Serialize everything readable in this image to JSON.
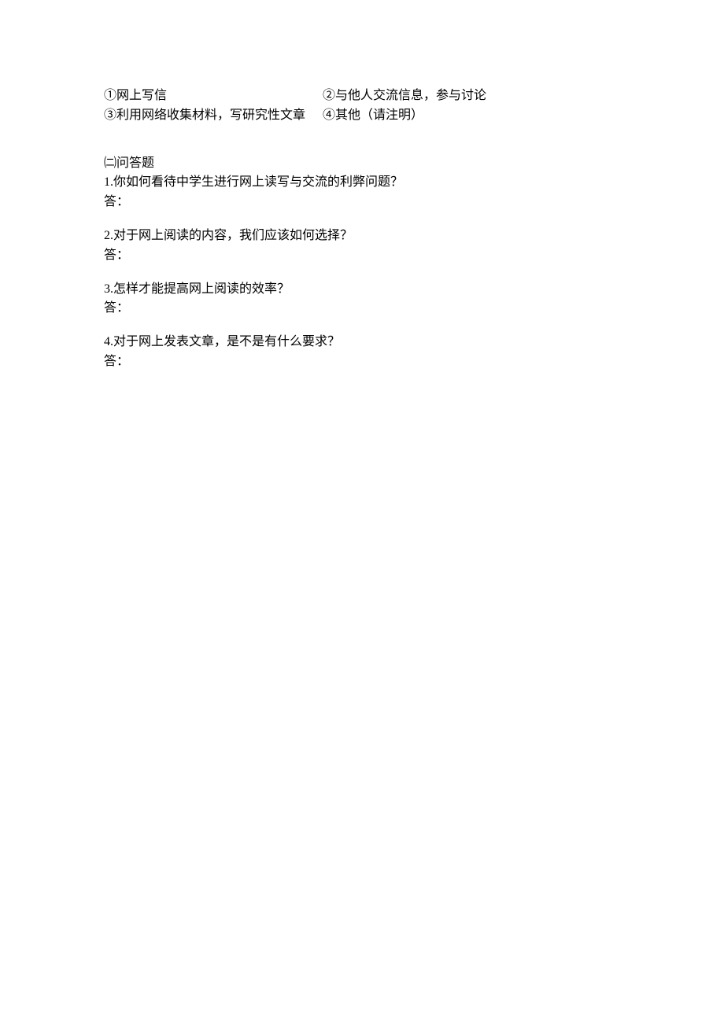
{
  "options": {
    "opt1": "①网上写信",
    "opt2": "②与他人交流信息，参与讨论",
    "opt3": "③利用网络收集材料，写研究性文章",
    "opt4": "④其他（请注明）"
  },
  "section_heading": "㈡问答题",
  "questions": {
    "q1": {
      "text": "1.你如何看待中学生进行网上读写与交流的利弊问题？",
      "answer_label": "答："
    },
    "q2": {
      "text": "2.对于网上阅读的内容，我们应该如何选择？",
      "answer_label": "答："
    },
    "q3": {
      "text": "3.怎样才能提高网上阅读的效率？",
      "answer_label": "答："
    },
    "q4": {
      "text": "4.对于网上发表文章，是不是有什么要求？",
      "answer_label": "答："
    }
  }
}
